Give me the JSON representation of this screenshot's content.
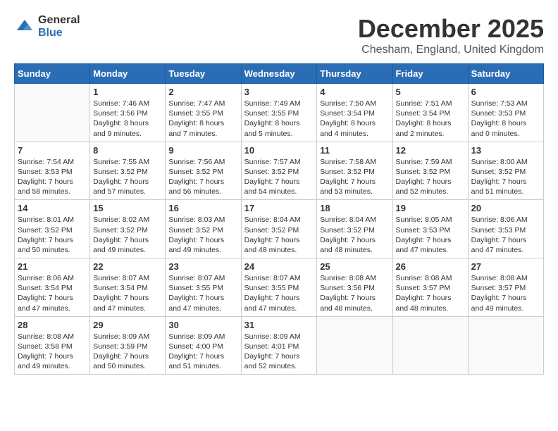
{
  "logo": {
    "general": "General",
    "blue": "Blue"
  },
  "title": "December 2025",
  "location": "Chesham, England, United Kingdom",
  "headers": [
    "Sunday",
    "Monday",
    "Tuesday",
    "Wednesday",
    "Thursday",
    "Friday",
    "Saturday"
  ],
  "weeks": [
    [
      {
        "day": "",
        "info": ""
      },
      {
        "day": "1",
        "info": "Sunrise: 7:46 AM\nSunset: 3:56 PM\nDaylight: 8 hours\nand 9 minutes."
      },
      {
        "day": "2",
        "info": "Sunrise: 7:47 AM\nSunset: 3:55 PM\nDaylight: 8 hours\nand 7 minutes."
      },
      {
        "day": "3",
        "info": "Sunrise: 7:49 AM\nSunset: 3:55 PM\nDaylight: 8 hours\nand 5 minutes."
      },
      {
        "day": "4",
        "info": "Sunrise: 7:50 AM\nSunset: 3:54 PM\nDaylight: 8 hours\nand 4 minutes."
      },
      {
        "day": "5",
        "info": "Sunrise: 7:51 AM\nSunset: 3:54 PM\nDaylight: 8 hours\nand 2 minutes."
      },
      {
        "day": "6",
        "info": "Sunrise: 7:53 AM\nSunset: 3:53 PM\nDaylight: 8 hours\nand 0 minutes."
      }
    ],
    [
      {
        "day": "7",
        "info": "Sunrise: 7:54 AM\nSunset: 3:53 PM\nDaylight: 7 hours\nand 58 minutes."
      },
      {
        "day": "8",
        "info": "Sunrise: 7:55 AM\nSunset: 3:52 PM\nDaylight: 7 hours\nand 57 minutes."
      },
      {
        "day": "9",
        "info": "Sunrise: 7:56 AM\nSunset: 3:52 PM\nDaylight: 7 hours\nand 56 minutes."
      },
      {
        "day": "10",
        "info": "Sunrise: 7:57 AM\nSunset: 3:52 PM\nDaylight: 7 hours\nand 54 minutes."
      },
      {
        "day": "11",
        "info": "Sunrise: 7:58 AM\nSunset: 3:52 PM\nDaylight: 7 hours\nand 53 minutes."
      },
      {
        "day": "12",
        "info": "Sunrise: 7:59 AM\nSunset: 3:52 PM\nDaylight: 7 hours\nand 52 minutes."
      },
      {
        "day": "13",
        "info": "Sunrise: 8:00 AM\nSunset: 3:52 PM\nDaylight: 7 hours\nand 51 minutes."
      }
    ],
    [
      {
        "day": "14",
        "info": "Sunrise: 8:01 AM\nSunset: 3:52 PM\nDaylight: 7 hours\nand 50 minutes."
      },
      {
        "day": "15",
        "info": "Sunrise: 8:02 AM\nSunset: 3:52 PM\nDaylight: 7 hours\nand 49 minutes."
      },
      {
        "day": "16",
        "info": "Sunrise: 8:03 AM\nSunset: 3:52 PM\nDaylight: 7 hours\nand 49 minutes."
      },
      {
        "day": "17",
        "info": "Sunrise: 8:04 AM\nSunset: 3:52 PM\nDaylight: 7 hours\nand 48 minutes."
      },
      {
        "day": "18",
        "info": "Sunrise: 8:04 AM\nSunset: 3:52 PM\nDaylight: 7 hours\nand 48 minutes."
      },
      {
        "day": "19",
        "info": "Sunrise: 8:05 AM\nSunset: 3:53 PM\nDaylight: 7 hours\nand 47 minutes."
      },
      {
        "day": "20",
        "info": "Sunrise: 8:06 AM\nSunset: 3:53 PM\nDaylight: 7 hours\nand 47 minutes."
      }
    ],
    [
      {
        "day": "21",
        "info": "Sunrise: 8:06 AM\nSunset: 3:54 PM\nDaylight: 7 hours\nand 47 minutes."
      },
      {
        "day": "22",
        "info": "Sunrise: 8:07 AM\nSunset: 3:54 PM\nDaylight: 7 hours\nand 47 minutes."
      },
      {
        "day": "23",
        "info": "Sunrise: 8:07 AM\nSunset: 3:55 PM\nDaylight: 7 hours\nand 47 minutes."
      },
      {
        "day": "24",
        "info": "Sunrise: 8:07 AM\nSunset: 3:55 PM\nDaylight: 7 hours\nand 47 minutes."
      },
      {
        "day": "25",
        "info": "Sunrise: 8:08 AM\nSunset: 3:56 PM\nDaylight: 7 hours\nand 48 minutes."
      },
      {
        "day": "26",
        "info": "Sunrise: 8:08 AM\nSunset: 3:57 PM\nDaylight: 7 hours\nand 48 minutes."
      },
      {
        "day": "27",
        "info": "Sunrise: 8:08 AM\nSunset: 3:57 PM\nDaylight: 7 hours\nand 49 minutes."
      }
    ],
    [
      {
        "day": "28",
        "info": "Sunrise: 8:08 AM\nSunset: 3:58 PM\nDaylight: 7 hours\nand 49 minutes."
      },
      {
        "day": "29",
        "info": "Sunrise: 8:09 AM\nSunset: 3:59 PM\nDaylight: 7 hours\nand 50 minutes."
      },
      {
        "day": "30",
        "info": "Sunrise: 8:09 AM\nSunset: 4:00 PM\nDaylight: 7 hours\nand 51 minutes."
      },
      {
        "day": "31",
        "info": "Sunrise: 8:09 AM\nSunset: 4:01 PM\nDaylight: 7 hours\nand 52 minutes."
      },
      {
        "day": "",
        "info": ""
      },
      {
        "day": "",
        "info": ""
      },
      {
        "day": "",
        "info": ""
      }
    ]
  ]
}
